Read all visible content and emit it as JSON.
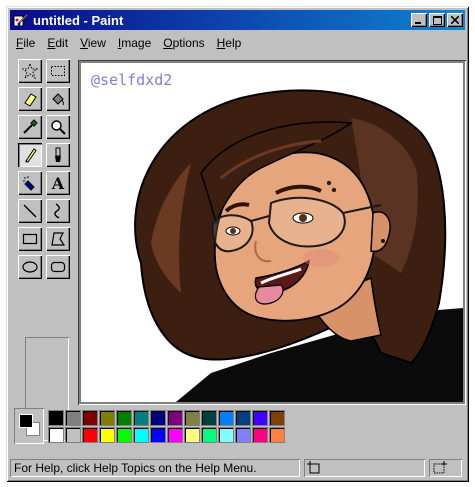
{
  "window": {
    "title": "untitled - Paint",
    "minimize_icon": "minimize-icon",
    "maximize_icon": "maximize-icon",
    "close_icon": "close-icon"
  },
  "menu": [
    {
      "accel": "F",
      "rest": "ile"
    },
    {
      "accel": "E",
      "rest": "dit"
    },
    {
      "accel": "V",
      "rest": "iew"
    },
    {
      "accel": "I",
      "rest": "mage"
    },
    {
      "accel": "O",
      "rest": "ptions"
    },
    {
      "accel": "H",
      "rest": "elp"
    }
  ],
  "tools": [
    {
      "name": "free-form-select",
      "icon": "star-select-icon"
    },
    {
      "name": "rectangle-select",
      "icon": "rect-select-icon"
    },
    {
      "name": "eraser",
      "icon": "eraser-icon"
    },
    {
      "name": "fill-with-color",
      "icon": "paint-bucket-icon"
    },
    {
      "name": "pick-color",
      "icon": "eyedropper-icon"
    },
    {
      "name": "magnifier",
      "icon": "magnifier-icon"
    },
    {
      "name": "pencil",
      "icon": "pencil-icon",
      "active": true
    },
    {
      "name": "brush",
      "icon": "brush-icon"
    },
    {
      "name": "airbrush",
      "icon": "airbrush-icon"
    },
    {
      "name": "text",
      "icon": "text-icon",
      "glyph": "A"
    },
    {
      "name": "line",
      "icon": "line-icon"
    },
    {
      "name": "curve",
      "icon": "curve-icon"
    },
    {
      "name": "rectangle",
      "icon": "rectangle-icon"
    },
    {
      "name": "polygon",
      "icon": "polygon-icon"
    },
    {
      "name": "ellipse",
      "icon": "ellipse-icon"
    },
    {
      "name": "rounded-rectangle",
      "icon": "rounded-rect-icon"
    }
  ],
  "canvas": {
    "watermark": "@selfdxd2",
    "artwork": "portrait-illustration"
  },
  "colors": {
    "foreground": "#000000",
    "background": "#ffffff",
    "palette": [
      "#000000",
      "#808080",
      "#800000",
      "#808000",
      "#008000",
      "#008080",
      "#000080",
      "#800080",
      "#808040",
      "#004040",
      "#0080ff",
      "#004080",
      "#4000ff",
      "#804000",
      "#ffffff",
      "#c0c0c0",
      "#ff0000",
      "#ffff00",
      "#00ff00",
      "#00ffff",
      "#0000ff",
      "#ff00ff",
      "#ffff80",
      "#00ff80",
      "#80ffff",
      "#8080ff",
      "#ff0080",
      "#ff8040"
    ]
  },
  "status": {
    "help_text": "For Help, click Help Topics on the Help Menu.",
    "position_icon": "cursor-position-icon",
    "size_icon": "selection-size-icon"
  }
}
